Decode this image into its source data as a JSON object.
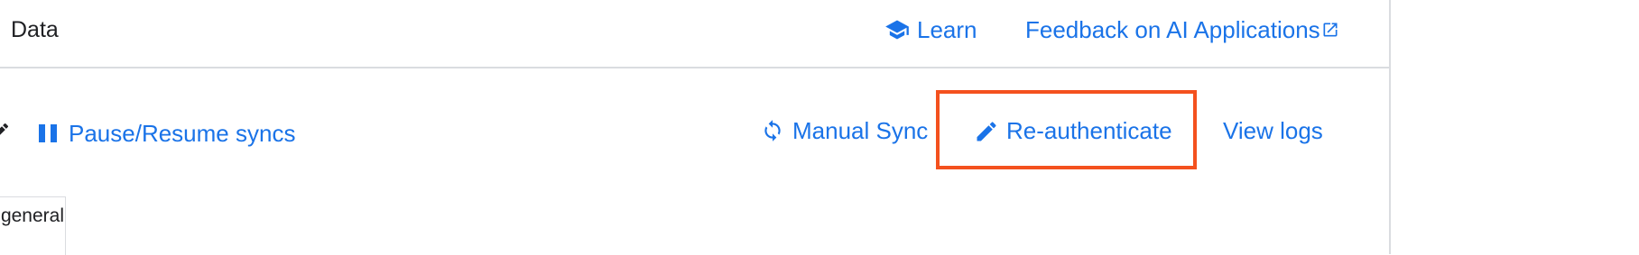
{
  "header": {
    "title": "Data",
    "learn_label": "Learn",
    "feedback_label": "Feedback on AI Applications"
  },
  "toolbar": {
    "pause_resume_label": "Pause/Resume syncs",
    "manual_sync_label": "Manual Sync",
    "reauthenticate_label": "Re-authenticate",
    "view_logs_label": "View logs"
  },
  "content": {
    "partial_cell_text": "general"
  },
  "colors": {
    "link": "#1a73e8",
    "highlight_box": "#f4511e",
    "divider": "#dadce0",
    "text": "#202124"
  },
  "icons": {
    "learn": "school-icon",
    "feedback": "open-in-new-icon",
    "edit_partial": "pencil-icon",
    "pause": "pause-icon",
    "manual_sync": "sync-icon",
    "reauthenticate": "pencil-icon"
  }
}
